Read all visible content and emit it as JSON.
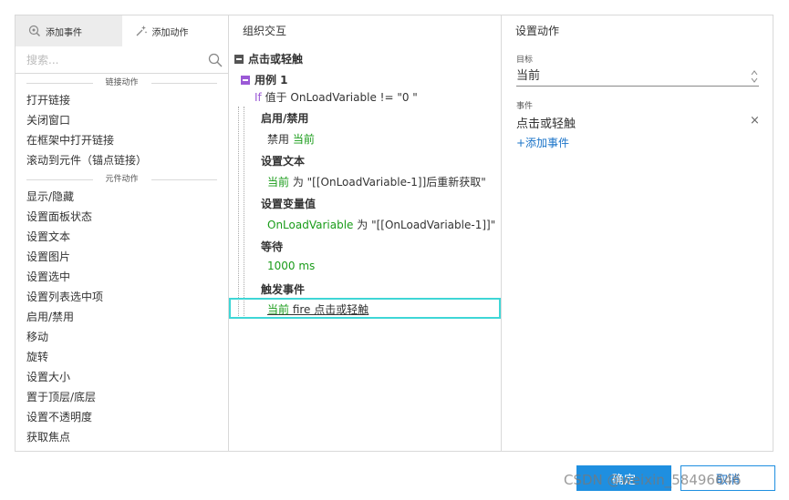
{
  "left_panel": {
    "tabs": [
      {
        "label": "添加事件",
        "icon": "add-event-icon"
      },
      {
        "label": "添加动作",
        "icon": "add-action-icon"
      }
    ],
    "search_placeholder": "搜索...",
    "sections": [
      {
        "title": "链接动作",
        "items": [
          "打开链接",
          "关闭窗口",
          "在框架中打开链接",
          "滚动到元件（锚点链接）"
        ]
      },
      {
        "title": "元件动作",
        "items": [
          "显示/隐藏",
          "设置面板状态",
          "设置文本",
          "设置图片",
          "设置选中",
          "设置列表选中项",
          "启用/禁用",
          "移动",
          "旋转",
          "设置大小",
          "置于顶层/底层",
          "设置不透明度",
          "获取焦点"
        ]
      }
    ]
  },
  "middle_panel": {
    "title": "组织交互",
    "event": "点击或轻触",
    "case": "用例 1",
    "condition": {
      "keyword": "If",
      "text": "值于 OnLoadVariable != \"0 \""
    },
    "actions": [
      {
        "title": "启用/禁用",
        "detail_prefix": "禁用 ",
        "detail_target": "当前",
        "detail_suffix": ""
      },
      {
        "title": "设置文本",
        "detail_prefix": "",
        "detail_target": "当前",
        "detail_suffix": " 为 \"[[OnLoadVariable-1]]后重新获取\""
      },
      {
        "title": "设置变量值",
        "detail_prefix": "",
        "detail_target": "OnLoadVariable",
        "detail_suffix": " 为 \"[[OnLoadVariable-1]]\""
      },
      {
        "title": "等待",
        "detail_prefix": "",
        "detail_target": "1000 ms",
        "detail_suffix": ""
      },
      {
        "title": "触发事件",
        "detail_prefix": "",
        "detail_target": "当前",
        "detail_suffix": " fire 点击或轻触"
      }
    ]
  },
  "right_panel": {
    "title": "设置动作",
    "target_label": "目标",
    "target_value": "当前",
    "event_label": "事件",
    "event_value": "点击或轻触",
    "close_glyph": "×",
    "add_event": "+添加事件"
  },
  "footer": {
    "ok": "确定",
    "cancel": "取消",
    "watermark": "CSDN @weixin_58496646"
  },
  "colors": {
    "accent_blue": "#1f8fe0",
    "green_value": "#1a9c1a",
    "purple": "#9b59d6",
    "selection": "#3fd6d6",
    "event_square": "#555555",
    "case_square": "#9b59d6"
  }
}
